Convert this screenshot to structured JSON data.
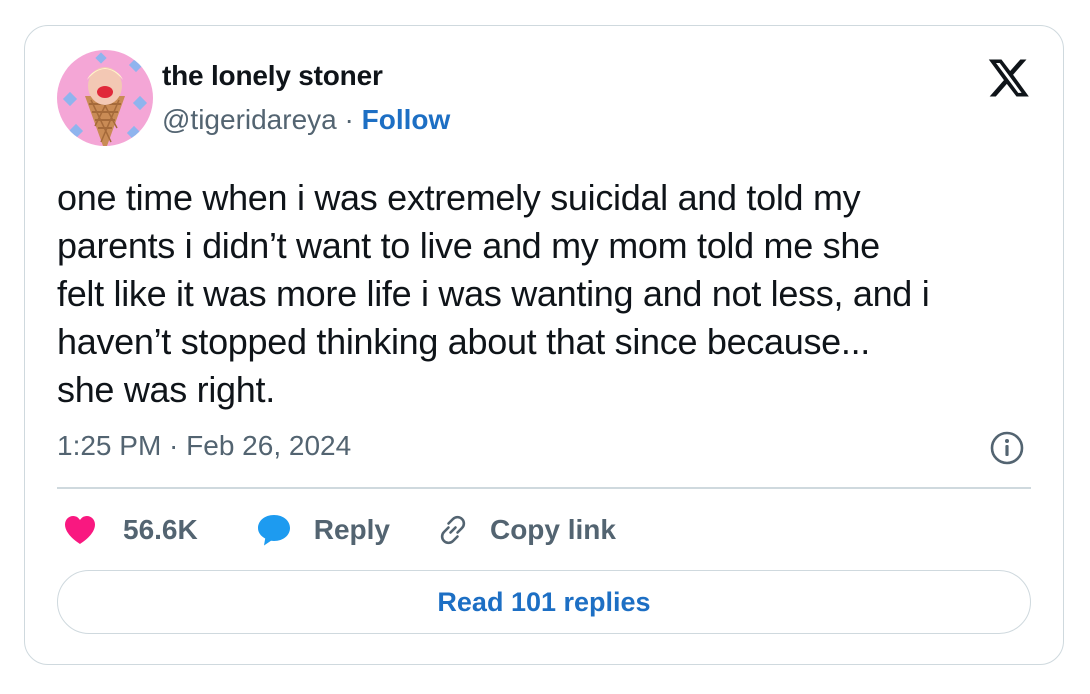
{
  "author": {
    "name": "the lonely stoner",
    "handle": "@tigeridareya",
    "separator": " · ",
    "follow_label": "Follow"
  },
  "tweet": {
    "text": "one time when i was extremely suicidal and told my\nparents i didn’t want to live and my mom told me she\nfelt like it was more life i was wanting and not less, and i\nhaven’t stopped thinking about that since because...\nshe was right.",
    "timestamp": "1:25 PM · Feb 26, 2024"
  },
  "actions": {
    "likes_count": "56.6K",
    "reply_label": "Reply",
    "copy_link_label": "Copy link",
    "read_replies_label": "Read 101 replies"
  },
  "icons": {
    "brand": "x-logo-icon",
    "like": "heart-icon",
    "reply": "speech-bubble-icon",
    "copy": "link-icon",
    "info": "info-icon"
  },
  "colors": {
    "text": "#0f1419",
    "secondary": "#536471",
    "link": "#1d6fc4",
    "heart": "#f91880",
    "reply_bubble": "#1d9bf0",
    "border": "#cfd9de"
  }
}
